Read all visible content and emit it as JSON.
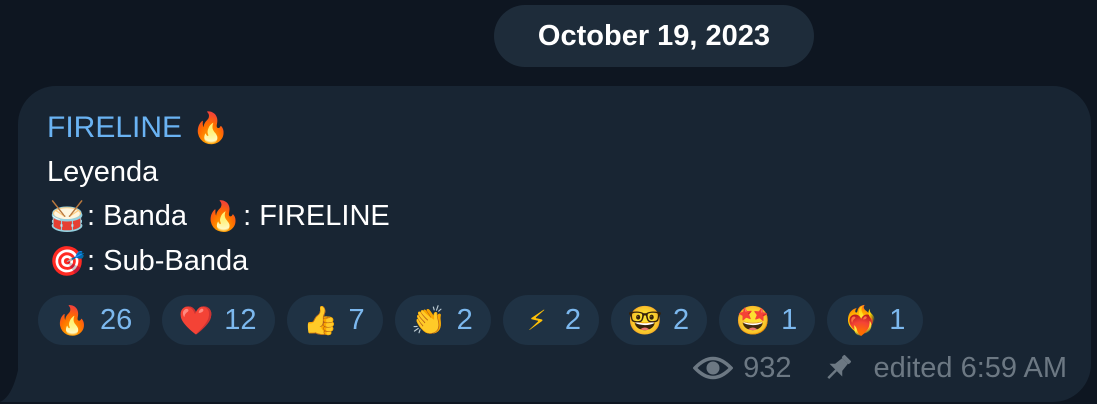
{
  "date_separator": "October 19, 2023",
  "message": {
    "sender_name": "FIRELINE",
    "sender_emoji": "🔥",
    "lines": [
      {
        "text": "Leyenda"
      },
      {
        "parts": [
          {
            "emoji": "🥁",
            "text": ": Banda  "
          },
          {
            "emoji": "🔥",
            "text": ": FIRELINE"
          }
        ]
      },
      {
        "parts": [
          {
            "emoji": "🎯",
            "text": ": Sub-Banda"
          }
        ]
      }
    ],
    "reactions": [
      {
        "emoji": "🔥",
        "count": "26",
        "icon": "fire-icon"
      },
      {
        "emoji": "❤️",
        "count": "12",
        "icon": "heart-icon"
      },
      {
        "emoji": "👍",
        "count": "7",
        "icon": "thumbs-up-icon"
      },
      {
        "emoji": "👏",
        "count": "2",
        "icon": "clapping-hands-icon"
      },
      {
        "emoji": "⚡",
        "count": "2",
        "icon": "lightning-icon"
      },
      {
        "emoji": "🤓",
        "count": "2",
        "icon": "nerd-face-icon"
      },
      {
        "emoji": "🤩",
        "count": "1",
        "icon": "star-struck-icon"
      },
      {
        "emoji": "❤️‍🔥",
        "count": "1",
        "icon": "heart-on-fire-icon"
      }
    ],
    "views": "932",
    "edited_label": "edited 6:59 AM"
  },
  "colors": {
    "background": "#0e1621",
    "bubble": "#182533",
    "date_pill": "#1e2c3a",
    "sender_name": "#6ab3f3",
    "reaction_bg": "#1f3244",
    "reaction_count": "#7cb8ee",
    "meta_text": "#6c7883"
  }
}
